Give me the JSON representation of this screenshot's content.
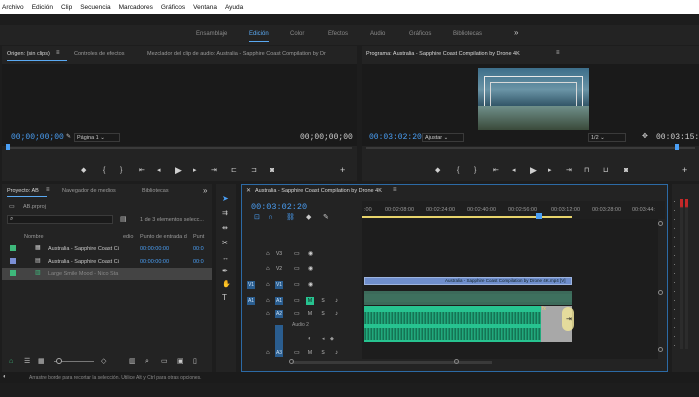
{
  "menu": [
    "Archivo",
    "Edición",
    "Clip",
    "Secuencia",
    "Marcadores",
    "Gráficos",
    "Ventana",
    "Ayuda"
  ],
  "workspaces": [
    "Ensamblaje",
    "Edición",
    "Color",
    "Efectos",
    "Audio",
    "Gráficos",
    "Bibliotecas"
  ],
  "workspace_more": "»",
  "source_panel": {
    "tabs": [
      "Origen: (sin clips)",
      "Controles de efectos",
      "Mezclador del clip de audio: Australia - Sapphire Coast Compilation by Dr"
    ],
    "timecode_left": "00;00;00;00",
    "page_label": "Página 1",
    "timecode_right": "00;00;00;00"
  },
  "program_panel": {
    "title": "Programa: Australia - Sapphire Coast Compilation by Drone 4K",
    "timecode_left": "00:03:02:20",
    "fit_label": "Ajustar",
    "ratio": "1/2",
    "timecode_right": "00:03:15:04"
  },
  "project_panel": {
    "tabs": [
      "Proyecto: AB",
      "Navegador de medios",
      "Bibliotecas"
    ],
    "more": "»",
    "project_file": "AB.prproj",
    "count_text": "1 de 3 elementos selecc...",
    "columns": [
      "Nombre",
      "edio",
      "Punto de entrada d",
      "Punt"
    ],
    "rows": [
      {
        "name": "Australia - Sapphire Coast Ci",
        "in": "00:00:00:00",
        "out": "00:0",
        "color": "#3eb87b",
        "selected": false
      },
      {
        "name": "Australia - Sapphire Coast Ci",
        "in": "00:00:00:00",
        "out": "00:0",
        "color": "#7b8fd6",
        "selected": false
      },
      {
        "name": "Large Smile Mood - Nico Sta",
        "in": "",
        "out": "",
        "color": "#3eb87b",
        "selected": true
      }
    ]
  },
  "timeline": {
    "tab": "Australia - Sapphire Coast Compilation by Drone 4K",
    "timecode": "00:03:02:20",
    "ruler": [
      ":00",
      "00:02:08:00",
      "00:02:24:00",
      "00:02:40:00",
      "00:02:56:00",
      "00:03:12:00",
      "00:03:28:00",
      "00:03:44:"
    ],
    "video_tracks": [
      "V3",
      "V2",
      "V1"
    ],
    "audio_tracks": [
      "A1",
      "A2",
      "A3"
    ],
    "source_v": "V1",
    "source_a": "A1",
    "audio2_label": "Audio 2",
    "clip_label": "Australia - Sapphire Coast Compilation by Drone 4K.mp4 [V]",
    "fx_label": "fx"
  },
  "status_bar": "Arrastre borde para recortar la selección. Utilice Alt y Ctrl para otras opciones.",
  "colors": {
    "accent": "#4a9ff5",
    "audio_clip": "#27c390",
    "video_clip": "#6f8ecc",
    "selected_bar": "#e8d46b"
  }
}
